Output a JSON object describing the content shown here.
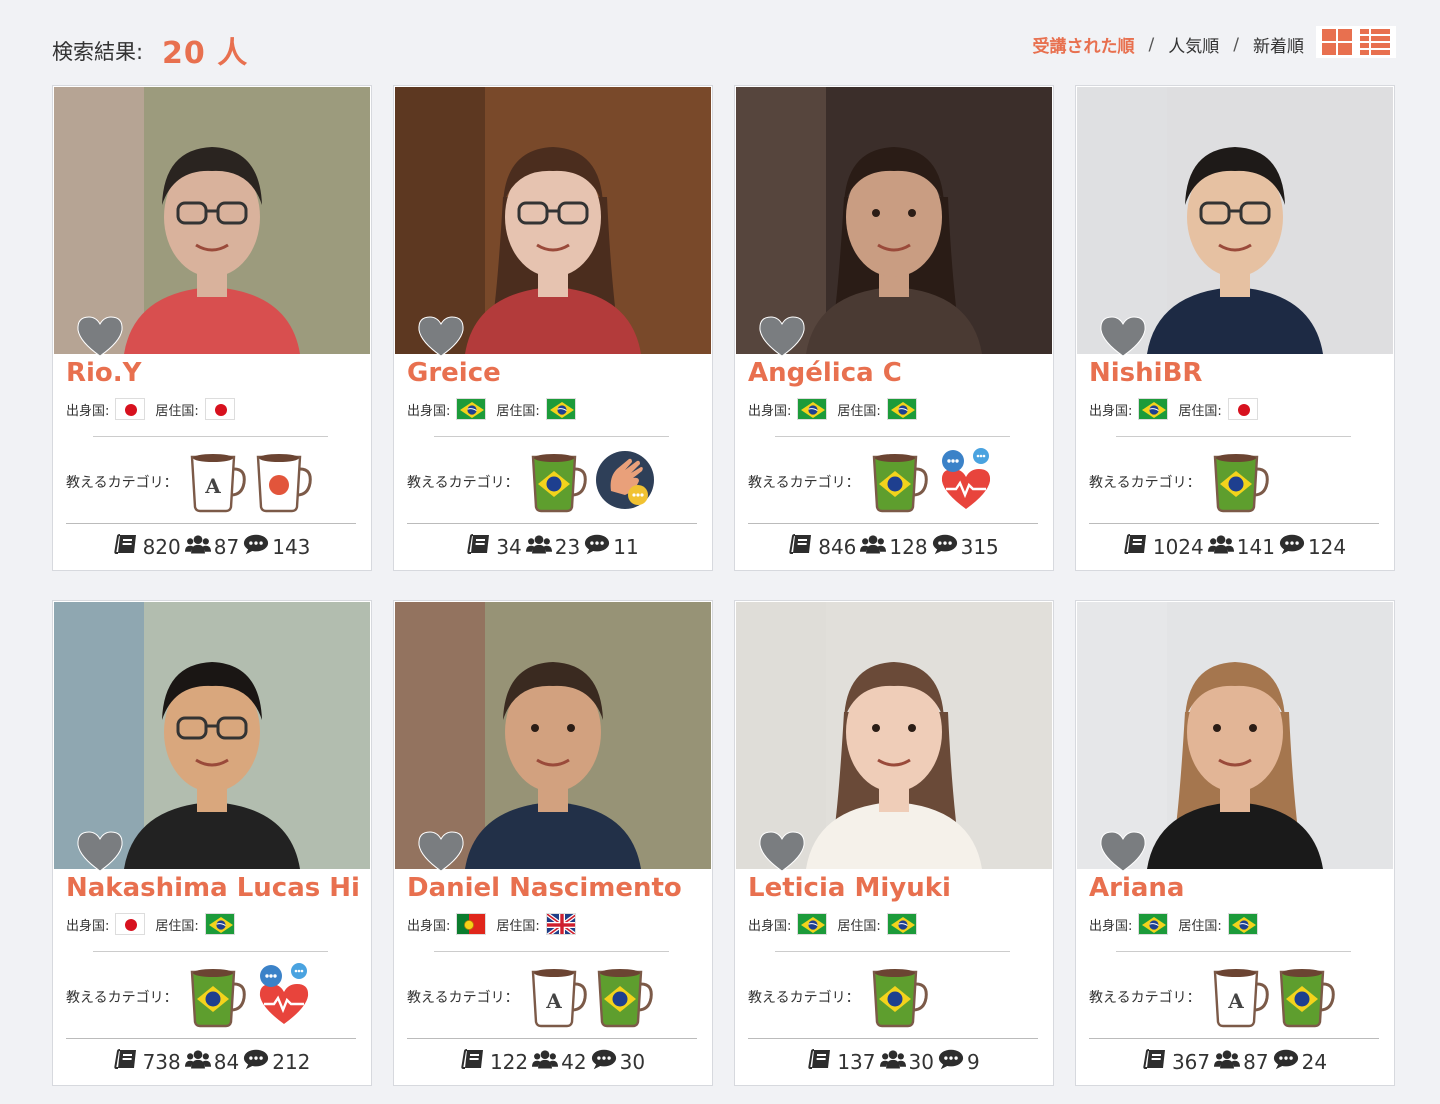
{
  "header": {
    "result_label": "検索結果:",
    "result_count": "20 人",
    "sort": {
      "active": "受講された順",
      "sep": "/",
      "option2": "人気順",
      "option3": "新着順"
    }
  },
  "labels": {
    "origin": "出身国:",
    "residence": "居住国:",
    "categories": "教えるカテゴリ："
  },
  "colors": {
    "accent": "#e8704f",
    "bg": "#f1f2f5"
  },
  "teachers": [
    {
      "name": "Rio.Y",
      "origin": "jp",
      "residence": "jp",
      "categories": [
        "english-mug",
        "japanese-mug"
      ],
      "lessons": "820",
      "students": "87",
      "reviews": "143"
    },
    {
      "name": "Greice",
      "origin": "br",
      "residence": "br",
      "categories": [
        "portuguese-mug",
        "conversation-hand-icon"
      ],
      "lessons": "34",
      "students": "23",
      "reviews": "11"
    },
    {
      "name": "Angélica C",
      "origin": "br",
      "residence": "br",
      "categories": [
        "portuguese-mug",
        "heart-chat-icon"
      ],
      "lessons": "846",
      "students": "128",
      "reviews": "315"
    },
    {
      "name": "NishiBR",
      "origin": "br",
      "residence": "jp",
      "categories": [
        "portuguese-mug"
      ],
      "lessons": "1024",
      "students": "141",
      "reviews": "124"
    },
    {
      "name": "Nakashima Lucas Hi",
      "origin": "jp",
      "residence": "br",
      "categories": [
        "portuguese-mug",
        "heart-chat-icon"
      ],
      "lessons": "738",
      "students": "84",
      "reviews": "212"
    },
    {
      "name": "Daniel Nascimento",
      "origin": "pt",
      "residence": "gb",
      "categories": [
        "english-mug",
        "portuguese-mug"
      ],
      "lessons": "122",
      "students": "42",
      "reviews": "30"
    },
    {
      "name": "Leticia Miyuki",
      "origin": "br",
      "residence": "br",
      "categories": [
        "portuguese-mug"
      ],
      "lessons": "137",
      "students": "30",
      "reviews": "9"
    },
    {
      "name": "Ariana",
      "origin": "br",
      "residence": "br",
      "categories": [
        "english-mug",
        "portuguese-mug"
      ],
      "lessons": "367",
      "students": "87",
      "reviews": "24"
    }
  ]
}
